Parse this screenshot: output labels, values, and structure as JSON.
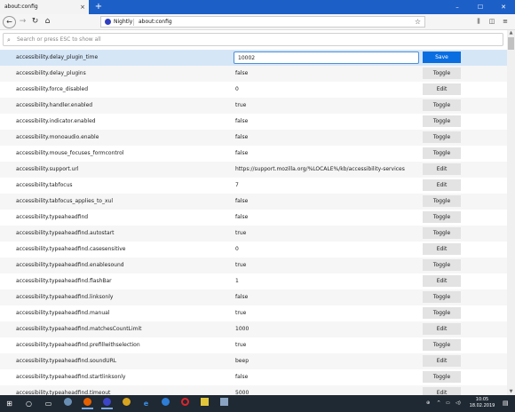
{
  "tab": {
    "title": "about:config",
    "close": "×"
  },
  "new_tab": "+",
  "window_controls": {
    "minimize": "–",
    "maximize": "☐",
    "close": "✕"
  },
  "nav": {
    "back": "←",
    "forward": "→",
    "reload": "↻",
    "home": "⌂"
  },
  "urlbar": {
    "brand": "Nightly",
    "url": "about:config",
    "star": "☆"
  },
  "toolbar_right": {
    "library": "⫼",
    "sidebar": "◫",
    "menu": "≡"
  },
  "search": {
    "placeholder": "Search or press ESC to show all",
    "icon": "search-icon"
  },
  "rows": [
    {
      "name": "accessibility.delay_plugin_time",
      "value": "10002",
      "action": "Save",
      "editing": true
    },
    {
      "name": "accessibility.delay_plugins",
      "value": "false",
      "action": "Toggle"
    },
    {
      "name": "accessibility.force_disabled",
      "value": "0",
      "action": "Edit"
    },
    {
      "name": "accessibility.handler.enabled",
      "value": "true",
      "action": "Toggle"
    },
    {
      "name": "accessibility.indicator.enabled",
      "value": "false",
      "action": "Toggle"
    },
    {
      "name": "accessibility.monoaudio.enable",
      "value": "false",
      "action": "Toggle"
    },
    {
      "name": "accessibility.mouse_focuses_formcontrol",
      "value": "false",
      "action": "Toggle"
    },
    {
      "name": "accessibility.support.url",
      "value": "https://support.mozilla.org/%LOCALE%/kb/accessibility-services",
      "action": "Edit"
    },
    {
      "name": "accessibility.tabfocus",
      "value": "7",
      "action": "Edit"
    },
    {
      "name": "accessibility.tabfocus_applies_to_xul",
      "value": "false",
      "action": "Toggle"
    },
    {
      "name": "accessibility.typeaheadfind",
      "value": "false",
      "action": "Toggle"
    },
    {
      "name": "accessibility.typeaheadfind.autostart",
      "value": "true",
      "action": "Toggle"
    },
    {
      "name": "accessibility.typeaheadfind.casesensitive",
      "value": "0",
      "action": "Edit"
    },
    {
      "name": "accessibility.typeaheadfind.enablesound",
      "value": "true",
      "action": "Toggle"
    },
    {
      "name": "accessibility.typeaheadfind.flashBar",
      "value": "1",
      "action": "Edit"
    },
    {
      "name": "accessibility.typeaheadfind.linksonly",
      "value": "false",
      "action": "Toggle"
    },
    {
      "name": "accessibility.typeaheadfind.manual",
      "value": "true",
      "action": "Toggle"
    },
    {
      "name": "accessibility.typeaheadfind.matchesCountLimit",
      "value": "1000",
      "action": "Edit"
    },
    {
      "name": "accessibility.typeaheadfind.prefillwithselection",
      "value": "true",
      "action": "Toggle"
    },
    {
      "name": "accessibility.typeaheadfind.soundURL",
      "value": "beep",
      "action": "Edit"
    },
    {
      "name": "accessibility.typeaheadfind.startlinksonly",
      "value": "false",
      "action": "Toggle"
    },
    {
      "name": "accessibility.typeaheadfind.timeout",
      "value": "5000",
      "action": "Edit"
    }
  ],
  "taskbar": {
    "start": "⊞",
    "search": "○",
    "task_view": "▭",
    "tray_chevron": "^",
    "tray_network": "▭",
    "tray_volume": "◁)",
    "tray_lang": "⊕",
    "notifications": "▤",
    "clock_time": "10:05",
    "clock_date": "18.02.2019"
  },
  "colors": {
    "tabstrip": "#1c5fc7",
    "accent": "#0a6ee0",
    "selected_row": "#d5e6f7"
  }
}
